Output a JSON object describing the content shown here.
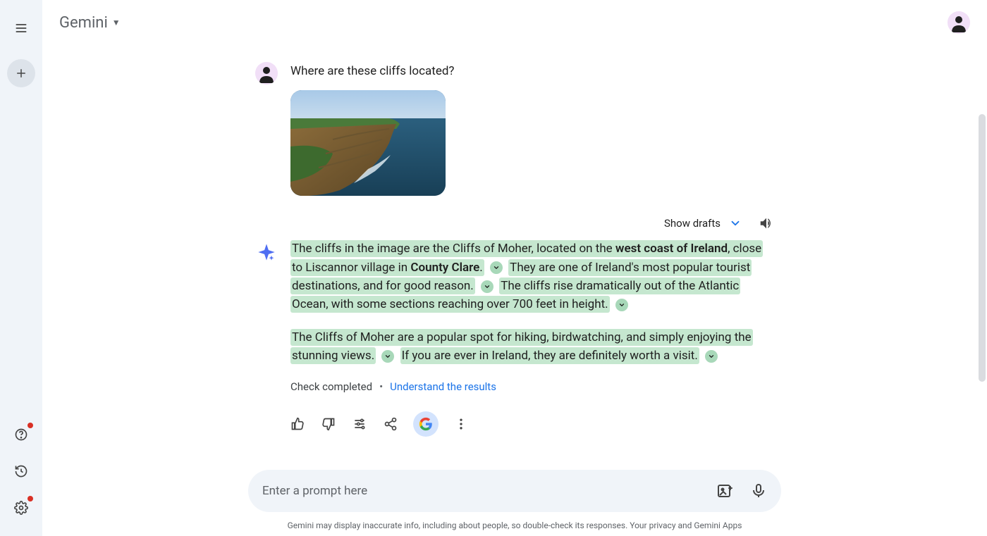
{
  "header": {
    "brand": "Gemini"
  },
  "conversation": {
    "user_question": "Where are these cliffs located?",
    "show_drafts_label": "Show drafts",
    "response": {
      "p1_s1_pre_bold1": "The cliffs in the image are the Cliffs of Moher, located on the ",
      "p1_bold1": "west coast of Ireland",
      "p1_s1_post_bold1": ", close to Liscannor village in ",
      "p1_bold2": "County Clare",
      "p1_s1_end": ".",
      "p1_s2": "They are one of Ireland's most popular tourist destinations, and for good reason.",
      "p1_s3": "The cliffs rise dramatically out of the Atlantic Ocean, with some sections reaching over 700 feet in height.",
      "p2_s1": "The Cliffs of Moher are a popular spot for hiking, birdwatching, and simply enjoying the stunning views.",
      "p2_s2": "If you are ever in Ireland, they are definitely worth a visit."
    },
    "check_completed": "Check completed",
    "understand_link": "Understand the results"
  },
  "input": {
    "placeholder": "Enter a prompt here"
  },
  "footer": {
    "disclaimer_text": "Gemini may display inaccurate info, including about people, so double-check its responses. ",
    "privacy_link": "Your privacy and Gemini Apps"
  }
}
